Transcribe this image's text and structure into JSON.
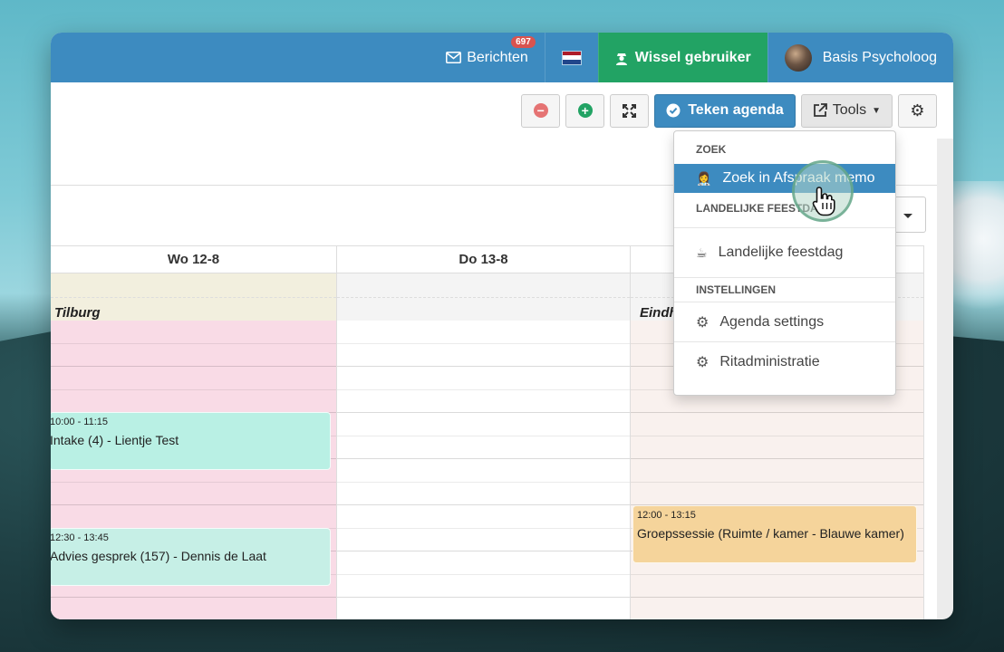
{
  "topbar": {
    "messages_label": "Berichten",
    "messages_badge": "697",
    "switch_user_label": "Wissel gebruiker",
    "user_name": "Basis Psycholoog",
    "flag_colors": [
      "#ae1c28",
      "#ffffff",
      "#21468b"
    ]
  },
  "toolbar": {
    "draw_agenda_label": "Teken agenda",
    "tools_label": "Tools"
  },
  "calendar": {
    "columns": [
      {
        "header": "Wo 12-8",
        "location": "Tilburg"
      },
      {
        "header": "Do 13-8",
        "location": ""
      },
      {
        "header": "",
        "location": "Eindh"
      }
    ],
    "appointments": [
      {
        "time": "10:00 - 11:15",
        "title": "Intake (4) - Lientje Test",
        "color": "#b9f0e4"
      },
      {
        "time": "12:30 - 13:45",
        "title": "Advies gesprek (157) - Dennis de Laat",
        "color": "#c6efe6"
      },
      {
        "time": "12:00 - 13:15",
        "title": "Groepssessie (Ruimte / kamer - Blauwe kamer)",
        "color": "#f5d49b"
      }
    ]
  },
  "dropdown": {
    "section_search": "ZOEK",
    "search_memo": "Zoek in Afspraak memo",
    "section_holiday": "LANDELIJKE FEESTDAG",
    "holiday": "Landelijke feestdag",
    "section_settings": "INSTELLINGEN",
    "agenda_settings": "Agenda settings",
    "trip_admin": "Ritadministratie"
  }
}
